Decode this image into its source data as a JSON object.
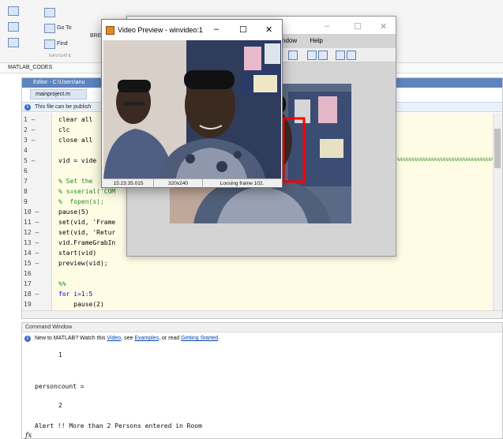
{
  "ribbon": {
    "goto_label": "Go To",
    "find_label": "Find",
    "section_navigate": "NAVIGATE",
    "section_other": "BRE"
  },
  "folder_bar": {
    "path": "MATLAB_CODES"
  },
  "editor": {
    "title": "Editor - C:\\Users\\anu",
    "tab": "mainproject.m",
    "info": "This file can be publish",
    "lines": [
      {
        "n": "1",
        "m": "–",
        "code": "clear all",
        "cls": ""
      },
      {
        "n": "2",
        "m": "–",
        "code": "clc",
        "cls": ""
      },
      {
        "n": "3",
        "m": "–",
        "code": "close all",
        "cls": ""
      },
      {
        "n": "4",
        "m": "",
        "code": "",
        "cls": ""
      },
      {
        "n": "5",
        "m": "–",
        "code": "vid = vide",
        "cls": ""
      },
      {
        "n": "6",
        "m": "",
        "code": "",
        "cls": ""
      },
      {
        "n": "7",
        "m": "",
        "code": "% Set the",
        "cls": "cm"
      },
      {
        "n": "8",
        "m": "",
        "code": "% s=serial('COM",
        "cls": "cm"
      },
      {
        "n": "9",
        "m": "",
        "code": "%  fopen(s);",
        "cls": "cm"
      },
      {
        "n": "10",
        "m": "–",
        "code": "pause(5)",
        "cls": ""
      },
      {
        "n": "11",
        "m": "–",
        "code": "set(vid, 'Frame",
        "cls": ""
      },
      {
        "n": "12",
        "m": "–",
        "code": "set(vid, 'Retur",
        "cls": ""
      },
      {
        "n": "13",
        "m": "–",
        "code": "vid.FrameGrabIn",
        "cls": ""
      },
      {
        "n": "14",
        "m": "–",
        "code": "start(vid)",
        "cls": ""
      },
      {
        "n": "15",
        "m": "–",
        "code": "preview(vid);",
        "cls": ""
      },
      {
        "n": "16",
        "m": "",
        "code": "",
        "cls": ""
      },
      {
        "n": "17",
        "m": "",
        "code": "%%",
        "cls": "cm"
      },
      {
        "n": "18",
        "m": "–",
        "code": "for i=1:5",
        "cls": "kw"
      },
      {
        "n": "19",
        "m": "",
        "code": "    pause(2)",
        "cls": ""
      }
    ],
    "hatch": "%%%%%%%%%%%%%%%%%%%%%%%%%%%%%%%%%%%"
  },
  "figure": {
    "menu_window": "ndow",
    "menu_help": "Help"
  },
  "preview": {
    "title": "Video Preview - winvideo:1",
    "minimize": "–",
    "maximize": "☐",
    "close": "✕",
    "status_time": "15:23:35.015",
    "status_res": "320x240",
    "status_frames": "Loosing frame 102."
  },
  "command_window": {
    "title": "Command Window",
    "info_prefix": "New to MATLAB? Watch this ",
    "link_video": "Video",
    "info_mid1": ", see ",
    "link_examples": "Examples",
    "info_mid2": ", or read ",
    "link_getting_started": "Getting Started",
    "info_end": ".",
    "out_1": "1",
    "out_var": "personcount =",
    "out_2": "2",
    "out_alert": "Alert !! More than 2 Persons entered in Room",
    "prompt": "fx"
  }
}
